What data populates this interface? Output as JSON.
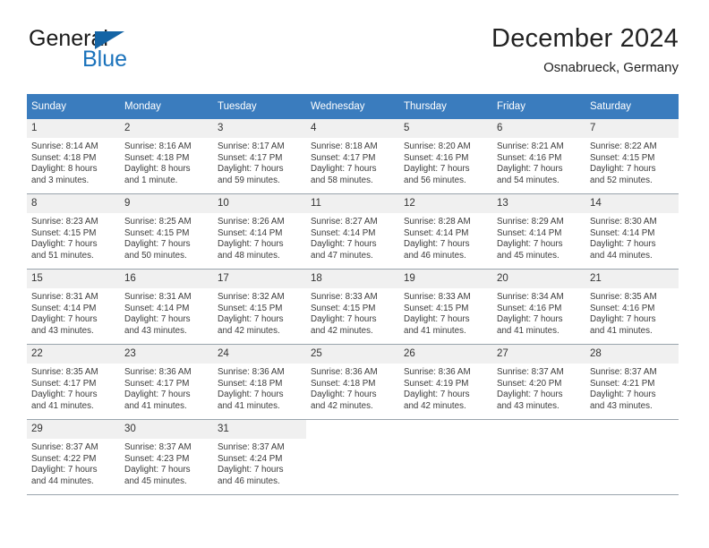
{
  "brand": {
    "name_part1": "General",
    "name_part2": "Blue",
    "logo_icon": "triangle-icon"
  },
  "header": {
    "title": "December 2024",
    "location": "Osnabrueck, Germany"
  },
  "colors": {
    "header_blue": "#3a7cbe",
    "brand_blue": "#1a72bb",
    "daynum_bg": "#f0f0f0",
    "row_border": "#9aa4ad"
  },
  "calendar": {
    "weekday_headers": [
      "Sunday",
      "Monday",
      "Tuesday",
      "Wednesday",
      "Thursday",
      "Friday",
      "Saturday"
    ],
    "weeks": [
      [
        {
          "day": "1",
          "sunrise": "Sunrise: 8:14 AM",
          "sunset": "Sunset: 4:18 PM",
          "daylight_line1": "Daylight: 8 hours",
          "daylight_line2": "and 3 minutes."
        },
        {
          "day": "2",
          "sunrise": "Sunrise: 8:16 AM",
          "sunset": "Sunset: 4:18 PM",
          "daylight_line1": "Daylight: 8 hours",
          "daylight_line2": "and 1 minute."
        },
        {
          "day": "3",
          "sunrise": "Sunrise: 8:17 AM",
          "sunset": "Sunset: 4:17 PM",
          "daylight_line1": "Daylight: 7 hours",
          "daylight_line2": "and 59 minutes."
        },
        {
          "day": "4",
          "sunrise": "Sunrise: 8:18 AM",
          "sunset": "Sunset: 4:17 PM",
          "daylight_line1": "Daylight: 7 hours",
          "daylight_line2": "and 58 minutes."
        },
        {
          "day": "5",
          "sunrise": "Sunrise: 8:20 AM",
          "sunset": "Sunset: 4:16 PM",
          "daylight_line1": "Daylight: 7 hours",
          "daylight_line2": "and 56 minutes."
        },
        {
          "day": "6",
          "sunrise": "Sunrise: 8:21 AM",
          "sunset": "Sunset: 4:16 PM",
          "daylight_line1": "Daylight: 7 hours",
          "daylight_line2": "and 54 minutes."
        },
        {
          "day": "7",
          "sunrise": "Sunrise: 8:22 AM",
          "sunset": "Sunset: 4:15 PM",
          "daylight_line1": "Daylight: 7 hours",
          "daylight_line2": "and 52 minutes."
        }
      ],
      [
        {
          "day": "8",
          "sunrise": "Sunrise: 8:23 AM",
          "sunset": "Sunset: 4:15 PM",
          "daylight_line1": "Daylight: 7 hours",
          "daylight_line2": "and 51 minutes."
        },
        {
          "day": "9",
          "sunrise": "Sunrise: 8:25 AM",
          "sunset": "Sunset: 4:15 PM",
          "daylight_line1": "Daylight: 7 hours",
          "daylight_line2": "and 50 minutes."
        },
        {
          "day": "10",
          "sunrise": "Sunrise: 8:26 AM",
          "sunset": "Sunset: 4:14 PM",
          "daylight_line1": "Daylight: 7 hours",
          "daylight_line2": "and 48 minutes."
        },
        {
          "day": "11",
          "sunrise": "Sunrise: 8:27 AM",
          "sunset": "Sunset: 4:14 PM",
          "daylight_line1": "Daylight: 7 hours",
          "daylight_line2": "and 47 minutes."
        },
        {
          "day": "12",
          "sunrise": "Sunrise: 8:28 AM",
          "sunset": "Sunset: 4:14 PM",
          "daylight_line1": "Daylight: 7 hours",
          "daylight_line2": "and 46 minutes."
        },
        {
          "day": "13",
          "sunrise": "Sunrise: 8:29 AM",
          "sunset": "Sunset: 4:14 PM",
          "daylight_line1": "Daylight: 7 hours",
          "daylight_line2": "and 45 minutes."
        },
        {
          "day": "14",
          "sunrise": "Sunrise: 8:30 AM",
          "sunset": "Sunset: 4:14 PM",
          "daylight_line1": "Daylight: 7 hours",
          "daylight_line2": "and 44 minutes."
        }
      ],
      [
        {
          "day": "15",
          "sunrise": "Sunrise: 8:31 AM",
          "sunset": "Sunset: 4:14 PM",
          "daylight_line1": "Daylight: 7 hours",
          "daylight_line2": "and 43 minutes."
        },
        {
          "day": "16",
          "sunrise": "Sunrise: 8:31 AM",
          "sunset": "Sunset: 4:14 PM",
          "daylight_line1": "Daylight: 7 hours",
          "daylight_line2": "and 43 minutes."
        },
        {
          "day": "17",
          "sunrise": "Sunrise: 8:32 AM",
          "sunset": "Sunset: 4:15 PM",
          "daylight_line1": "Daylight: 7 hours",
          "daylight_line2": "and 42 minutes."
        },
        {
          "day": "18",
          "sunrise": "Sunrise: 8:33 AM",
          "sunset": "Sunset: 4:15 PM",
          "daylight_line1": "Daylight: 7 hours",
          "daylight_line2": "and 42 minutes."
        },
        {
          "day": "19",
          "sunrise": "Sunrise: 8:33 AM",
          "sunset": "Sunset: 4:15 PM",
          "daylight_line1": "Daylight: 7 hours",
          "daylight_line2": "and 41 minutes."
        },
        {
          "day": "20",
          "sunrise": "Sunrise: 8:34 AM",
          "sunset": "Sunset: 4:16 PM",
          "daylight_line1": "Daylight: 7 hours",
          "daylight_line2": "and 41 minutes."
        },
        {
          "day": "21",
          "sunrise": "Sunrise: 8:35 AM",
          "sunset": "Sunset: 4:16 PM",
          "daylight_line1": "Daylight: 7 hours",
          "daylight_line2": "and 41 minutes."
        }
      ],
      [
        {
          "day": "22",
          "sunrise": "Sunrise: 8:35 AM",
          "sunset": "Sunset: 4:17 PM",
          "daylight_line1": "Daylight: 7 hours",
          "daylight_line2": "and 41 minutes."
        },
        {
          "day": "23",
          "sunrise": "Sunrise: 8:36 AM",
          "sunset": "Sunset: 4:17 PM",
          "daylight_line1": "Daylight: 7 hours",
          "daylight_line2": "and 41 minutes."
        },
        {
          "day": "24",
          "sunrise": "Sunrise: 8:36 AM",
          "sunset": "Sunset: 4:18 PM",
          "daylight_line1": "Daylight: 7 hours",
          "daylight_line2": "and 41 minutes."
        },
        {
          "day": "25",
          "sunrise": "Sunrise: 8:36 AM",
          "sunset": "Sunset: 4:18 PM",
          "daylight_line1": "Daylight: 7 hours",
          "daylight_line2": "and 42 minutes."
        },
        {
          "day": "26",
          "sunrise": "Sunrise: 8:36 AM",
          "sunset": "Sunset: 4:19 PM",
          "daylight_line1": "Daylight: 7 hours",
          "daylight_line2": "and 42 minutes."
        },
        {
          "day": "27",
          "sunrise": "Sunrise: 8:37 AM",
          "sunset": "Sunset: 4:20 PM",
          "daylight_line1": "Daylight: 7 hours",
          "daylight_line2": "and 43 minutes."
        },
        {
          "day": "28",
          "sunrise": "Sunrise: 8:37 AM",
          "sunset": "Sunset: 4:21 PM",
          "daylight_line1": "Daylight: 7 hours",
          "daylight_line2": "and 43 minutes."
        }
      ],
      [
        {
          "day": "29",
          "sunrise": "Sunrise: 8:37 AM",
          "sunset": "Sunset: 4:22 PM",
          "daylight_line1": "Daylight: 7 hours",
          "daylight_line2": "and 44 minutes."
        },
        {
          "day": "30",
          "sunrise": "Sunrise: 8:37 AM",
          "sunset": "Sunset: 4:23 PM",
          "daylight_line1": "Daylight: 7 hours",
          "daylight_line2": "and 45 minutes."
        },
        {
          "day": "31",
          "sunrise": "Sunrise: 8:37 AM",
          "sunset": "Sunset: 4:24 PM",
          "daylight_line1": "Daylight: 7 hours",
          "daylight_line2": "and 46 minutes."
        },
        {
          "day": "",
          "sunrise": "",
          "sunset": "",
          "daylight_line1": "",
          "daylight_line2": ""
        },
        {
          "day": "",
          "sunrise": "",
          "sunset": "",
          "daylight_line1": "",
          "daylight_line2": ""
        },
        {
          "day": "",
          "sunrise": "",
          "sunset": "",
          "daylight_line1": "",
          "daylight_line2": ""
        },
        {
          "day": "",
          "sunrise": "",
          "sunset": "",
          "daylight_line1": "",
          "daylight_line2": ""
        }
      ]
    ]
  }
}
